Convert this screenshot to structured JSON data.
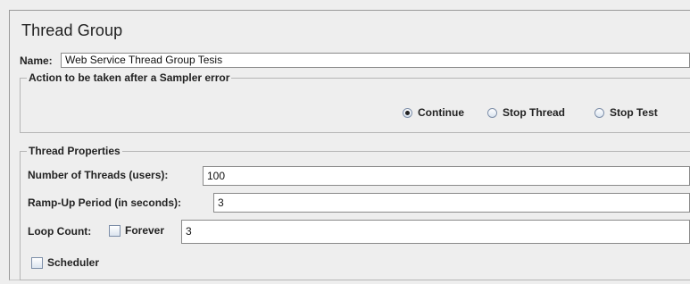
{
  "panel": {
    "title": "Thread Group",
    "name_label": "Name:",
    "name_value": "Web Service Thread Group Tesis"
  },
  "sampler_error": {
    "legend": "Action to be taken after a Sampler error",
    "options": [
      {
        "label": "Continue",
        "selected": true
      },
      {
        "label": "Stop Thread",
        "selected": false
      },
      {
        "label": "Stop Test",
        "selected": false
      }
    ]
  },
  "thread_properties": {
    "legend": "Thread Properties",
    "threads_label": "Number of Threads (users):",
    "threads_value": "100",
    "rampup_label": "Ramp-Up Period (in seconds):",
    "rampup_value": "3",
    "loop_label": "Loop Count:",
    "forever_label": "Forever",
    "forever_checked": false,
    "loop_value": "3",
    "scheduler_label": "Scheduler",
    "scheduler_checked": false
  }
}
